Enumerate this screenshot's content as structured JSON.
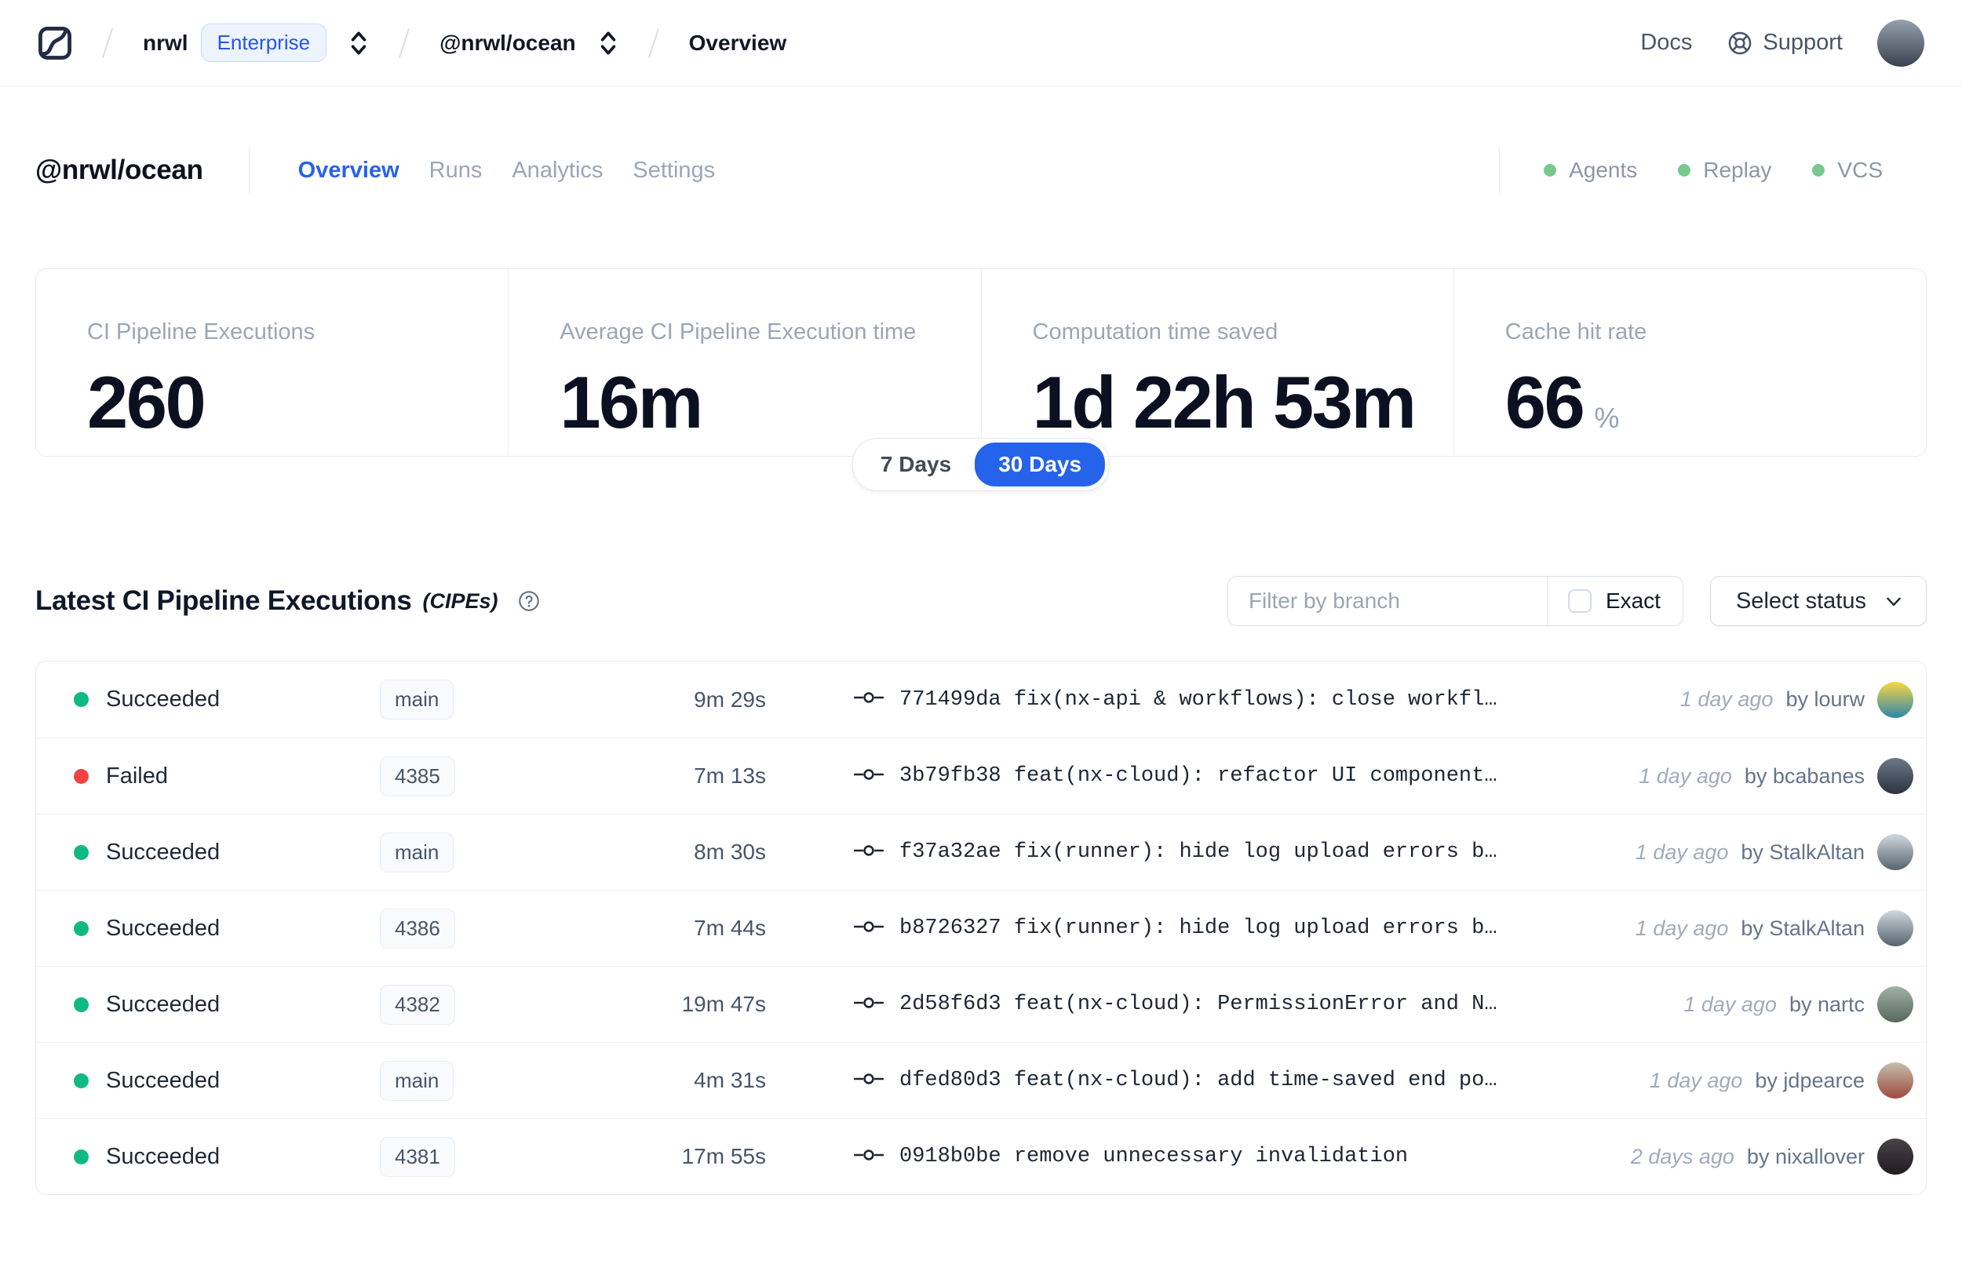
{
  "topnav": {
    "org": "nrwl",
    "org_badge": "Enterprise",
    "workspace": "@nrwl/ocean",
    "page": "Overview",
    "docs_label": "Docs",
    "support_label": "Support"
  },
  "header": {
    "title": "@nrwl/ocean",
    "tabs": [
      {
        "label": "Overview",
        "active": true
      },
      {
        "label": "Runs",
        "active": false
      },
      {
        "label": "Analytics",
        "active": false
      },
      {
        "label": "Settings",
        "active": false
      }
    ],
    "statuses": [
      {
        "label": "Agents"
      },
      {
        "label": "Replay"
      },
      {
        "label": "VCS"
      }
    ]
  },
  "stats": {
    "cards": [
      {
        "label": "CI Pipeline Executions",
        "value": "260",
        "suffix": ""
      },
      {
        "label": "Average CI Pipeline Execution time",
        "value": "16m",
        "suffix": ""
      },
      {
        "label": "Computation time saved",
        "value": "1d 22h 53m",
        "suffix": ""
      },
      {
        "label": "Cache hit rate",
        "value": "66",
        "suffix": "%"
      }
    ],
    "range_toggle": {
      "options": [
        "7 Days",
        "30 Days"
      ],
      "selected": "30 Days"
    }
  },
  "cipe_section": {
    "title": "Latest CI Pipeline Executions",
    "title_suffix": "(CIPEs)",
    "filter_placeholder": "Filter by branch",
    "exact_label": "Exact",
    "status_select_label": "Select status",
    "rows": [
      {
        "status": "Succeeded",
        "branch": "main",
        "duration": "9m 29s",
        "commit": "771499da fix(nx-api & workflows): close workfl…",
        "time": "1 day ago",
        "author": "by lourw",
        "avatar": {
          "c1": "#f6d743",
          "c2": "#2e86ab"
        }
      },
      {
        "status": "Failed",
        "branch": "4385",
        "duration": "7m 13s",
        "commit": "3b79fb38 feat(nx-cloud): refactor UI component…",
        "time": "1 day ago",
        "author": "by bcabanes",
        "avatar": {
          "c1": "#6d7886",
          "c2": "#2b3340"
        }
      },
      {
        "status": "Succeeded",
        "branch": "main",
        "duration": "8m 30s",
        "commit": "f37a32ae fix(runner): hide log upload errors b…",
        "time": "1 day ago",
        "author": "by StalkAltan",
        "avatar": {
          "c1": "#cfd8de",
          "c2": "#55646e"
        }
      },
      {
        "status": "Succeeded",
        "branch": "4386",
        "duration": "7m 44s",
        "commit": "b8726327 fix(runner): hide log upload errors b…",
        "time": "1 day ago",
        "author": "by StalkAltan",
        "avatar": {
          "c1": "#cfd8de",
          "c2": "#55646e"
        }
      },
      {
        "status": "Succeeded",
        "branch": "4382",
        "duration": "19m 47s",
        "commit": "2d58f6d3 feat(nx-cloud): PermissionError and N…",
        "time": "1 day ago",
        "author": "by nartc",
        "avatar": {
          "c1": "#9fb2a5",
          "c2": "#55695c"
        }
      },
      {
        "status": "Succeeded",
        "branch": "main",
        "duration": "4m 31s",
        "commit": "dfed80d3 feat(nx-cloud): add time-saved end po…",
        "time": "1 day ago",
        "author": "by jdpearce",
        "avatar": {
          "c1": "#c4bfae",
          "c2": "#9e4a3d"
        }
      },
      {
        "status": "Succeeded",
        "branch": "4381",
        "duration": "17m 55s",
        "commit": "0918b0be remove unnecessary invalidation",
        "time": "2 days ago",
        "author": "by nixallover",
        "avatar": {
          "c1": "#4a4248",
          "c2": "#201c20"
        }
      }
    ]
  },
  "user_avatar": {
    "c1": "#97a0ad",
    "c2": "#3a4250"
  },
  "colors": {
    "accent": "#2563eb",
    "succeeded": "#10b981",
    "failed": "#ef4444",
    "header_dot": "#77c98d",
    "logo_stroke": "#232c42"
  },
  "icons": {
    "logo": "nx-cloud-logo",
    "support": "lifebuoy",
    "help": "question-circle",
    "breadcrumb_select": "chevron-up-down",
    "status_select": "chevron-down",
    "commit": "git-commit"
  }
}
